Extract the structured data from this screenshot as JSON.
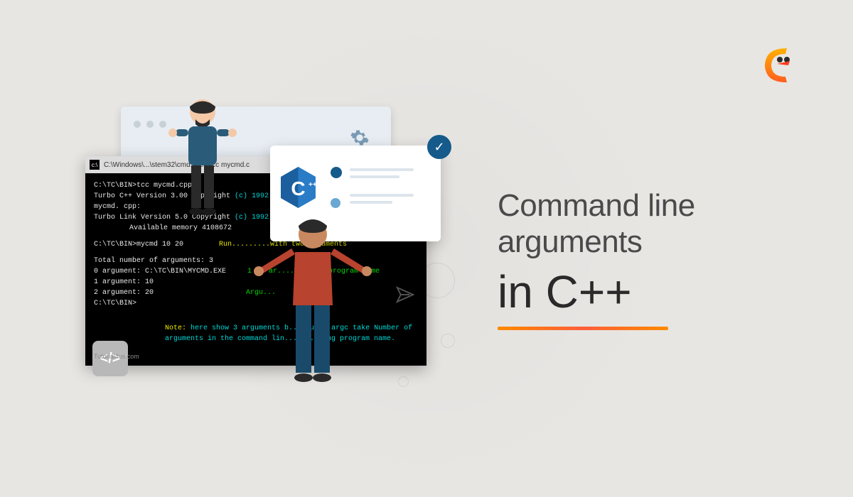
{
  "logo": {
    "brand_color_start": "#ff8a00",
    "brand_color_end": "#ff3a3a"
  },
  "terminal": {
    "title": "C:\\Windows\\...\\stem32\\cmd.exe - tcc  mycmd.c",
    "prompt1": "C:\\TC\\BIN>tcc mycmd.cpp",
    "compiler_line1": "Turbo C++  Version 3.00 Copyright ",
    "compiler_copyright": "(c) 1992 Borland International",
    "compiler_file": "mycmd. cpp:",
    "linker_line": "Turbo Link   Version 5.0 Copyright ",
    "memory_line": "Available memory 4108672",
    "prompt2": "C:\\TC\\BIN>mycmd 10 20",
    "run_note": "Run.........with two Arguments",
    "total_line": "Total number of arguments: 3",
    "arg0_label": " 0 argument: C:\\TC\\BIN\\MYCMD.EXE",
    "arg0_note": "1 st ar.........is program name",
    "arg1_label": " 1 argument: 10",
    "arg2_label": " 2 argument: 20",
    "arg_note": "Argu...",
    "prompt3": "C:\\TC\\BIN>",
    "note_prefix": "Note:",
    "note_body1": "here show 3 arguments b....aus...argc take Number of",
    "note_body2": "arguments in the command lin...ncl....ng program name.",
    "watermark": "Tutorial4us.com"
  },
  "headline": {
    "line1a": "Command line",
    "line1b": "arguments",
    "line2": "in C++"
  },
  "cpp_logo": {
    "text": "C",
    "plus": "++"
  },
  "code_badge": {
    "glyph": "</>"
  }
}
